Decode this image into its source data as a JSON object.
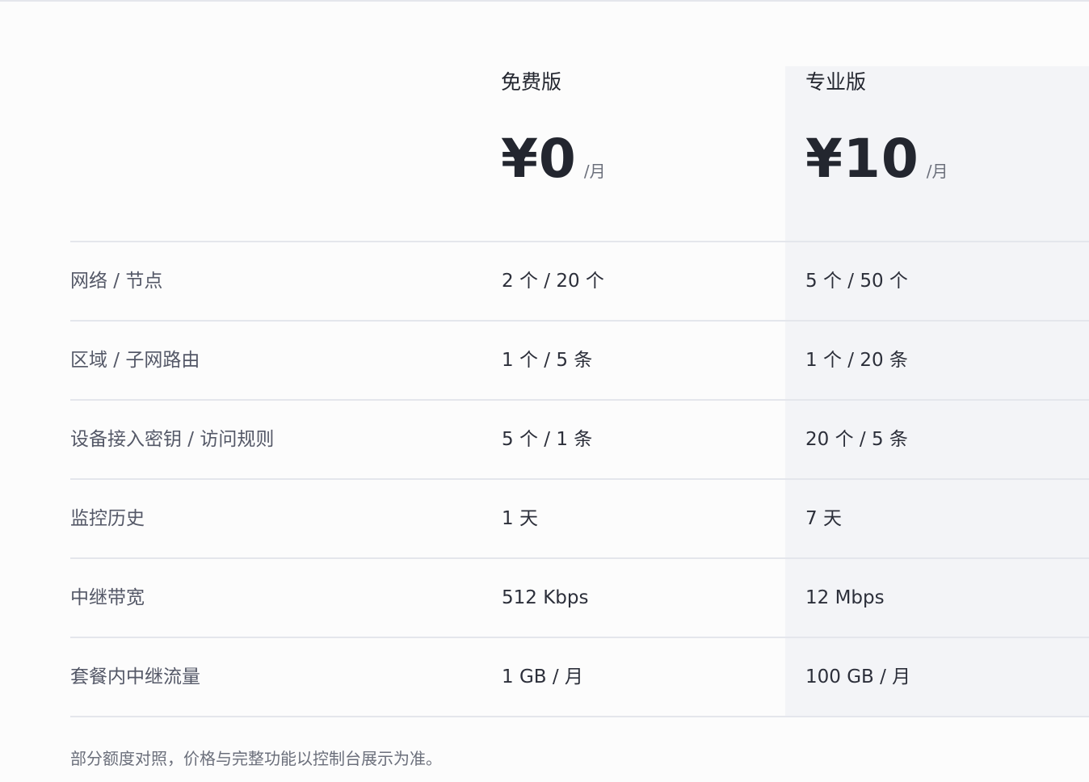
{
  "plans": [
    {
      "name": "免费版",
      "price": "¥0",
      "period": "/月"
    },
    {
      "name": "专业版",
      "price": "¥10",
      "period": "/月"
    }
  ],
  "rows": [
    {
      "feature": "网络 / 节点",
      "free": "2 个 / 20 个",
      "pro": "5 个 / 50 个"
    },
    {
      "feature": "区域 / 子网路由",
      "free": "1 个 / 5 条",
      "pro": "1 个 / 20 条"
    },
    {
      "feature": "设备接入密钥 / 访问规则",
      "free": "5 个 / 1 条",
      "pro": "20 个 / 5 条"
    },
    {
      "feature": "监控历史",
      "free": "1 天",
      "pro": "7 天"
    },
    {
      "feature": "中继带宽",
      "free": "512 Kbps",
      "pro": "12 Mbps"
    },
    {
      "feature": "套餐内中继流量",
      "free": "1 GB / 月",
      "pro": "100 GB / 月"
    }
  ],
  "footnote": "部分额度对照，价格与完整功能以控制台展示为准。"
}
